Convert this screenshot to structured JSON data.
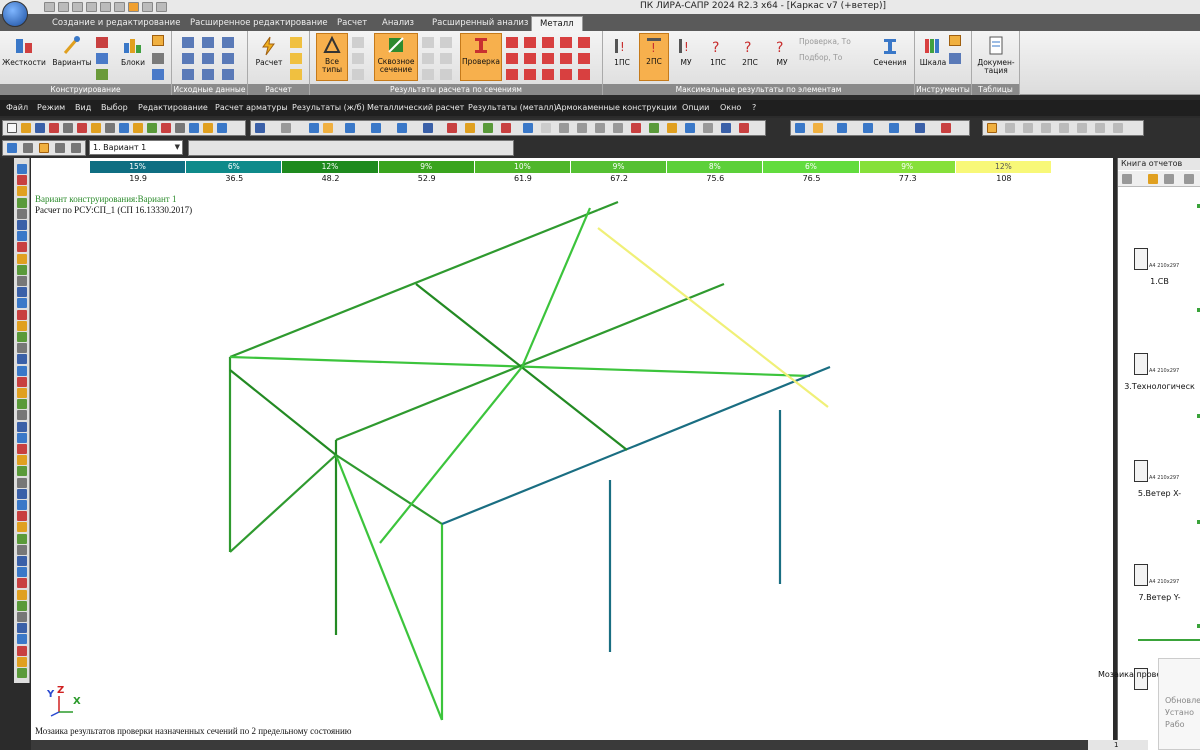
{
  "window": {
    "title": "ПК ЛИРА-САПР  2024 R2.3 x64 - [Каркас v7 (+ветер)]"
  },
  "ribbon_tabs": [
    {
      "label": "Создание и редактирование"
    },
    {
      "label": "Расширенное редактирование"
    },
    {
      "label": "Расчет"
    },
    {
      "label": "Анализ"
    },
    {
      "label": "Расширенный анализ"
    },
    {
      "label": "Металл",
      "active": true
    }
  ],
  "ribbon": {
    "groups": [
      {
        "label": "Конструирование"
      },
      {
        "label": "Исходные данные"
      },
      {
        "label": "Расчет"
      },
      {
        "label": "Результаты расчета по сечениям"
      },
      {
        "label": "Максимальные результаты по элементам"
      },
      {
        "label": "Инструменты"
      },
      {
        "label": "Таблицы"
      }
    ],
    "buttons": {
      "stiffness": "Жесткости",
      "variants": "Варианты",
      "blocks": "Блоки",
      "calc": "Расчет",
      "all_types_1": "Все",
      "all_types_2": "типы",
      "through_1": "Сквозное",
      "through_2": "сечение",
      "check": "Проверка",
      "ps1": "1ПС",
      "ps2": "2ПС",
      "mu": "МУ",
      "ps1b": "1ПС",
      "ps2b": "2ПС",
      "mub": "МУ",
      "check_to": "Проверка, То",
      "select_to": "Подбор, То",
      "sections": "Сечения",
      "scale": "Шкала",
      "doc_1": "Докумен-",
      "doc_2": "тация"
    }
  },
  "menu": [
    "Файл",
    "Режим",
    "Вид",
    "Выбор",
    "Редактирование",
    "Расчет арматуры",
    "Результаты (ж/б)",
    "Металлический расчет",
    "Результаты (металл)",
    "Армокаменные конструкции",
    "Опции",
    "Окно",
    "?"
  ],
  "toolbar": {
    "variant_value": "1. Вариант 1"
  },
  "scale": {
    "percents": [
      "15%",
      "6%",
      "12%",
      "9%",
      "10%",
      "9%",
      "8%",
      "6%",
      "9%",
      "12%"
    ],
    "colors": [
      "#0f6e82",
      "#0f8a8a",
      "#1e8a1e",
      "#3aa41e",
      "#4fb62a",
      "#55c032",
      "#5cd03a",
      "#62dc3e",
      "#86e03a",
      "#f8f878"
    ],
    "values": [
      "19.9",
      "36.5",
      "48.2",
      "52.9",
      "61.9",
      "67.2",
      "75.6",
      "76.5",
      "77.3",
      "108"
    ]
  },
  "canvas": {
    "info_line1": "Вариант конструирования:Вариант 1",
    "info_line2": "Расчет по РСУ:СП_1 (СП 16.13330.2017)",
    "caption": "Мозаика результатов проверки назначенных сечений по 2 предельному состоянию",
    "axis_labels": {
      "x": "X",
      "y": "Y",
      "z": "Z"
    }
  },
  "report_panel": {
    "title": "Книга отчетов",
    "items": [
      {
        "size": "A4 210x297",
        "label": "1.СВ"
      },
      {
        "size": "A4 210x297",
        "label": "3.Технологическ"
      },
      {
        "size": "A4 210x297",
        "label": "5.Ветер X-"
      },
      {
        "size": "A4 210x297",
        "label": "7.Ветер Y-"
      },
      {
        "size": "",
        "label": "Мозаика проверк"
      }
    ],
    "notice_lines": [
      "Обновле",
      "Устано",
      "Рабо"
    ]
  },
  "status": {
    "page": "1"
  }
}
